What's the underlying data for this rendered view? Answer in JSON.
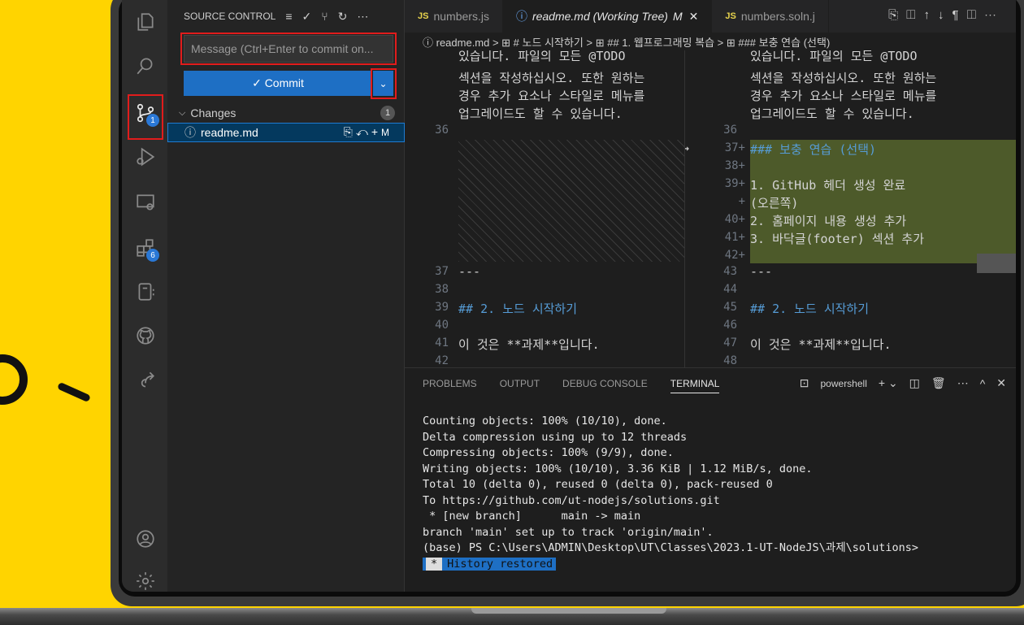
{
  "sidebar": {
    "title": "SOURCE CONTROL",
    "commit_placeholder": "Message (Ctrl+Enter to commit on...",
    "commit_label": "✓ Commit",
    "changes_label": "Changes",
    "changes_count": "1",
    "file_name": "readme.md",
    "file_status": "M"
  },
  "activity": {
    "scm_badge": "1",
    "extensions_badge": "6"
  },
  "tabs": [
    {
      "label": "numbers.js"
    },
    {
      "label": "readme.md (Working Tree)",
      "status": "M"
    },
    {
      "label": "numbers.soln.j"
    }
  ],
  "breadcrumb": "ⓘ readme.md > ⊞ # 노드 시작하기 > ⊞ ## 1. 웹프로그래밍 복습 > ⊞ ### 보충 연습 (선택)",
  "editor": {
    "left": {
      "wrapped_lines": [
        "있습니다. 파일의 모든 @TODO",
        "섹션을 작성하십시오. 또한 원하는",
        "경우 추가 요소나 스타일로 메뉴를",
        "업그레이드도 할 수 있습니다."
      ],
      "lines": [
        {
          "n": "36",
          "t": ""
        },
        {
          "n": "37",
          "t": "---"
        },
        {
          "n": "38",
          "t": ""
        },
        {
          "n": "39",
          "t": "## 2. 노드 시작하기"
        },
        {
          "n": "40",
          "t": ""
        },
        {
          "n": "41",
          "t": "이 것은 **과제**입니다."
        },
        {
          "n": "42",
          "t": ""
        }
      ]
    },
    "right": {
      "wrapped_lines": [
        "있습니다. 파일의 모든 @TODO",
        "섹션을 작성하십시오. 또한 원하는",
        "경우 추가 요소나 스타일로 메뉴를",
        "업그레이드도 할 수 있습니다."
      ],
      "lines": [
        {
          "n": "36",
          "t": ""
        },
        {
          "n": "37+",
          "t": "### 보충 연습 (선택)"
        },
        {
          "n": "38+",
          "t": ""
        },
        {
          "n": "39+",
          "t": "1. GitHub 헤더 생성 완료"
        },
        {
          "n": "+",
          "t": "(오른쪽)"
        },
        {
          "n": "40+",
          "t": "2. 홈페이지 내용 생성 추가"
        },
        {
          "n": "41+",
          "t": "3. 바닥글(footer) 섹션 추가"
        },
        {
          "n": "42+",
          "t": ""
        },
        {
          "n": "43",
          "t": "---"
        },
        {
          "n": "44",
          "t": ""
        },
        {
          "n": "45",
          "t": "## 2. 노드 시작하기"
        },
        {
          "n": "46",
          "t": ""
        },
        {
          "n": "47",
          "t": "이 것은 **과제**입니다."
        },
        {
          "n": "48",
          "t": ""
        }
      ]
    }
  },
  "panel": {
    "tabs": [
      "PROBLEMS",
      "OUTPUT",
      "DEBUG CONSOLE",
      "TERMINAL"
    ],
    "shell": "powershell",
    "terminal_lines": [
      "Counting objects: 100% (10/10), done.",
      "Delta compression using up to 12 threads",
      "Compressing objects: 100% (9/9), done.",
      "Writing objects: 100% (10/10), 3.36 KiB | 1.12 MiB/s, done.",
      "Total 10 (delta 0), reused 0 (delta 0), pack-reused 0",
      "To https://github.com/ut-nodejs/solutions.git",
      " * [new branch]      main -> main",
      "branch 'main' set up to track 'origin/main'.",
      "(base) PS C:\\Users\\ADMIN\\Desktop\\UT\\Classes\\2023.1-UT-NodeJS\\과제\\solutions>"
    ],
    "history_star": "*",
    "history_label": "History restored"
  }
}
